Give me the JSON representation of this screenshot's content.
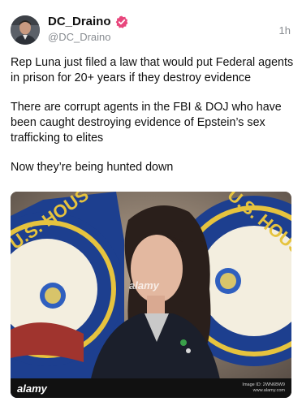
{
  "post": {
    "display_name": "DC_Draino",
    "handle": "@DC_Draino",
    "timestamp": "1h",
    "paragraphs": [
      "Rep Luna just filed a law that would put Federal agents in prison for 20+ years if they destroy evidence",
      "There are corrupt agents in the FBI & DOJ who have been caught destroying evidence of Epstein’s sex trafficking to elites",
      "Now they’re being hunted down"
    ]
  },
  "media": {
    "watermark": "alamy",
    "watermark_center": "alamy",
    "image_id": "Image ID: 2WN6BW9",
    "site": "www.alamy.com"
  },
  "icons": {
    "verified": "verified-badge-icon"
  },
  "colors": {
    "verified": "#e8467c",
    "secondary_text": "#888c91",
    "seal_blue": "#1d3f8f",
    "seal_gold": "#e6c33e"
  }
}
